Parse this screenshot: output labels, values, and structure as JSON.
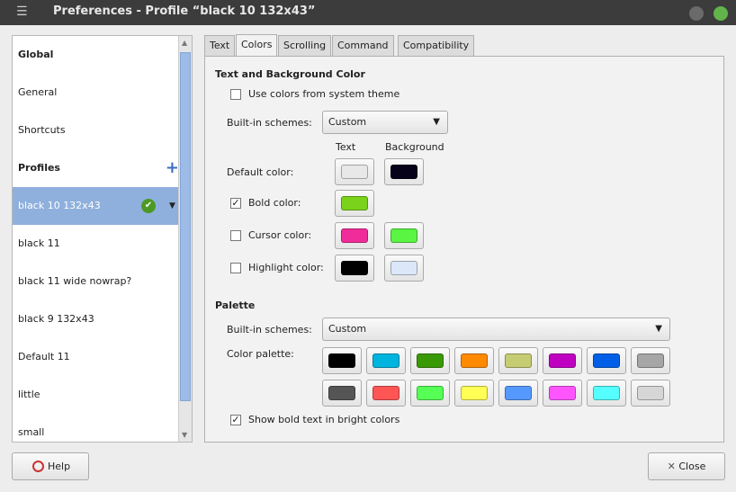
{
  "window": {
    "title": "Preferences - Profile “black 10 132x43”",
    "menu_icon": "hamburger-icon"
  },
  "sidebar": {
    "items": [
      {
        "label": "Global",
        "header": true
      },
      {
        "label": "General"
      },
      {
        "label": "Shortcuts"
      },
      {
        "label": "Profiles",
        "header": true
      },
      {
        "label": "black 10 132x43",
        "selected": true
      },
      {
        "label": "black 11"
      },
      {
        "label": "black 11 wide nowrap?"
      },
      {
        "label": "black 9  132x43"
      },
      {
        "label": "Default 11"
      },
      {
        "label": "little"
      },
      {
        "label": "small"
      }
    ]
  },
  "tabs": [
    "Text",
    "Colors",
    "Scrolling",
    "Command",
    "Compatibility"
  ],
  "colors": {
    "section1": "Text and Background Color",
    "use_system": {
      "label": "Use colors from system theme",
      "checked": false
    },
    "builtin_label": "Built-in schemes:",
    "builtin_value": "Custom",
    "col_text": "Text",
    "col_bg": "Background",
    "default": {
      "label": "Default color:",
      "text": "#e8e8e8",
      "bg": "#05021a"
    },
    "bold": {
      "label": "Bold color:",
      "checked": true,
      "text": "#7ad31a"
    },
    "cursor": {
      "label": "Cursor color:",
      "checked": false,
      "text": "#f02c9a",
      "bg": "#5af542"
    },
    "highlight": {
      "label": "Highlight color:",
      "checked": false,
      "text": "#000000",
      "bg": "#dce8fa"
    },
    "section2": "Palette",
    "palette_builtin_label": "Built-in schemes:",
    "palette_builtin_value": "Custom",
    "palette_label": "Color palette:",
    "palette": [
      "#000000",
      "#00b4e0",
      "#3a9a06",
      "#ff8a00",
      "#c6cc72",
      "#c000c0",
      "#005fe6",
      "#a6a6a6",
      "#555555",
      "#ff5555",
      "#55ff55",
      "#ffff55",
      "#5599ff",
      "#ff55ff",
      "#55ffff",
      "#d6d6d6"
    ],
    "bright": {
      "label": "Show bold text in bright colors",
      "checked": true
    }
  },
  "buttons": {
    "help": "Help",
    "close": "Close"
  }
}
